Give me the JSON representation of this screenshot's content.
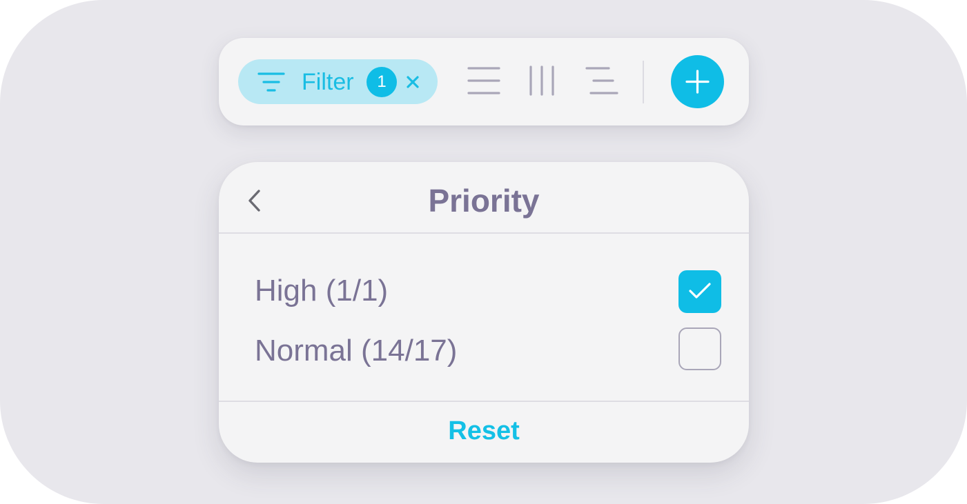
{
  "toolbar": {
    "filter_label": "Filter",
    "filter_count": "1",
    "filter_icon": "filter-icon",
    "clear_icon": "close-icon",
    "view_buttons": [
      "list-view-icon",
      "column-view-icon",
      "align-view-icon"
    ],
    "add_icon": "plus-icon"
  },
  "panel": {
    "back_icon": "chevron-left-icon",
    "title": "Priority",
    "options": [
      {
        "label": "High (1/1)",
        "checked": true
      },
      {
        "label": "Normal (14/17)",
        "checked": false
      }
    ],
    "reset_label": "Reset"
  },
  "colors": {
    "accent": "#0fbde6",
    "accent_light": "#b8e8f4",
    "text": "#7a7395",
    "icon_gray": "#a9a6b8",
    "background": "#e8e7ec",
    "card": "#f4f4f5"
  }
}
